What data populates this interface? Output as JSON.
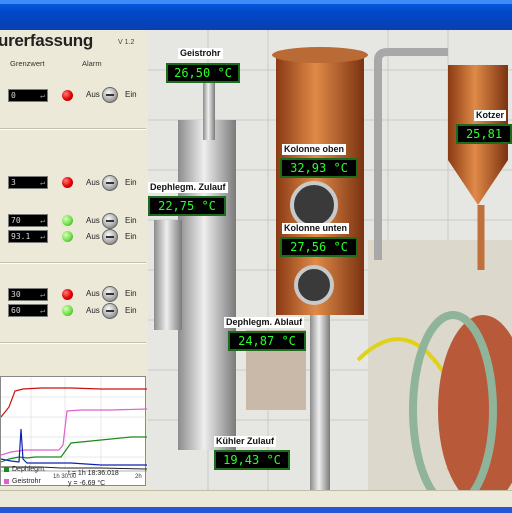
{
  "app": {
    "title": "urerfassung",
    "version": "V 1.2"
  },
  "columns": {
    "threshold": "Grenzwert",
    "alarm": "Alarm"
  },
  "alarms": [
    {
      "value": "0",
      "led": "red",
      "off": "Aus",
      "on": "Ein"
    },
    {
      "value": "3",
      "led": "red",
      "off": "Aus",
      "on": "Ein"
    },
    {
      "value": "70",
      "led": "green",
      "off": "Aus",
      "on": "Ein"
    },
    {
      "value": "93.1",
      "led": "green",
      "off": "Aus",
      "on": "Ein"
    },
    {
      "value": "30",
      "led": "red",
      "off": "Aus",
      "on": "Ein"
    },
    {
      "value": "60",
      "led": "green",
      "off": "Aus",
      "on": "Ein"
    }
  ],
  "enter_glyph": "↵",
  "chart": {
    "x_tick": "1h 30:00",
    "x_tick_right": "2h",
    "legend": [
      {
        "name": "Dephlegm.",
        "color": "#1a8a1a"
      },
      {
        "name": "Geistrohr",
        "color": "#e060d0"
      }
    ],
    "cursor_time": "t = 1h 18:36.018",
    "cursor_value": "y = -6.69 °C"
  },
  "sensors": [
    {
      "name": "Geistrohr",
      "value": "26,50 °C"
    },
    {
      "name": "Kotzer",
      "value": "25,81"
    },
    {
      "name": "Kolonne oben",
      "value": "32,93 °C"
    },
    {
      "name": "Dephlegm. Zulauf",
      "value": "22,75 °C"
    },
    {
      "name": "Kolonne unten",
      "value": "27,56 °C"
    },
    {
      "name": "Dephlegm. Ablauf",
      "value": "24,87 °C"
    },
    {
      "name": "Kühler Zulauf",
      "value": "19,43 °C"
    }
  ]
}
